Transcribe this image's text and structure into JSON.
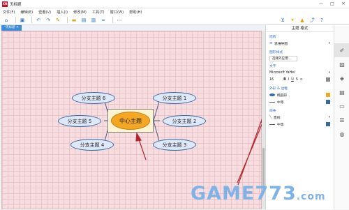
{
  "window": {
    "title": "无标题",
    "logo": "XN",
    "controls": [
      "—",
      "□",
      "✕"
    ]
  },
  "menu": [
    "文件(F)",
    "编辑(E)",
    "查看(V)",
    "插入(I)",
    "修改(M)",
    "工具(T)",
    "窗口(W)",
    "帮助(H)"
  ],
  "toolbar_icons": [
    "home-icon",
    "save-icon",
    "undo-icon",
    "redo-icon",
    "paint-icon",
    "folder-icon",
    "topic-icon",
    "subtopic-icon",
    "link-icon",
    "more-icon",
    "filter-icon",
    "idea-icon",
    "warning-icon",
    "share-icon",
    "help-icon"
  ],
  "tab": {
    "label": "*无标题 ✕"
  },
  "mindmap": {
    "central": "中心主题",
    "branches": [
      "分支主题 1",
      "分支主题 2",
      "分支主题 3",
      "分支主题 4",
      "分支主题 5",
      "分支主题 6"
    ]
  },
  "panel": {
    "title": "主题 格式",
    "structure_label": "结构",
    "structure_value": "思维导图",
    "style_label": "图形样式",
    "style_value": "选择外应用...",
    "text_label": "文字",
    "font_value": "Microsoft YaHei",
    "font_size": "16",
    "format_buttons": [
      "B",
      "I",
      "U",
      "S"
    ],
    "shape_label": "外形 & 边框",
    "shape_value": "椭圆形",
    "border_value": "中等",
    "line_label": "线条",
    "line_value": "直线",
    "line_width_value": "中等",
    "colors": {
      "shape_fill": "#f5a623",
      "border": "#3a67a8",
      "line_color": "#3a67a8",
      "swatch_gray": "#8a8a8a"
    }
  },
  "right_bar_icons": [
    "brush-icon",
    "image-icon",
    "marker-icon",
    "note-icon",
    "comment-icon",
    "task-icon",
    "outline-icon"
  ],
  "watermark": {
    "main": "GAME773",
    "suffix": ".com"
  }
}
